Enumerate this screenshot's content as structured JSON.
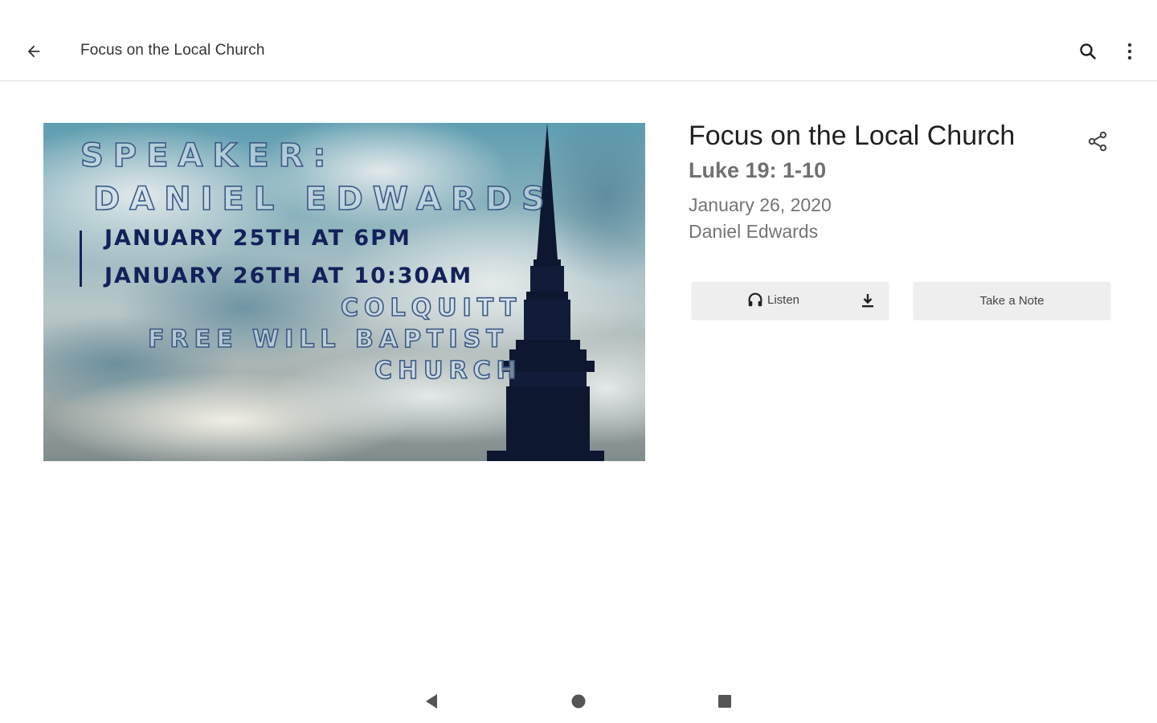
{
  "appbar": {
    "title": "Focus on the Local Church",
    "back_icon": "arrow-left-icon",
    "search_icon": "search-icon",
    "more_icon": "more-vertical-icon"
  },
  "artwork": {
    "lines": [
      "SPEAKER:",
      "DANIEL EDWARDS",
      "JANUARY 25TH AT 6PM",
      "JANUARY 26TH AT 10:30AM",
      "COLQUITT",
      "FREE WILL BAPTIST",
      "CHURCH"
    ]
  },
  "sermon": {
    "title": "Focus on the Local Church",
    "scripture": "Luke 19: 1-10",
    "date": "January 26, 2020",
    "speaker": "Daniel Edwards"
  },
  "actions": {
    "listen_label": "Listen",
    "note_label": "Take a Note",
    "share_icon": "share-icon",
    "download_icon": "download-icon",
    "headphones_icon": "headphones-icon"
  },
  "colors": {
    "title_text": "#212121",
    "secondary_text": "#757575",
    "button_bg": "#eeeeee",
    "art_text_dark": "#13215a"
  }
}
